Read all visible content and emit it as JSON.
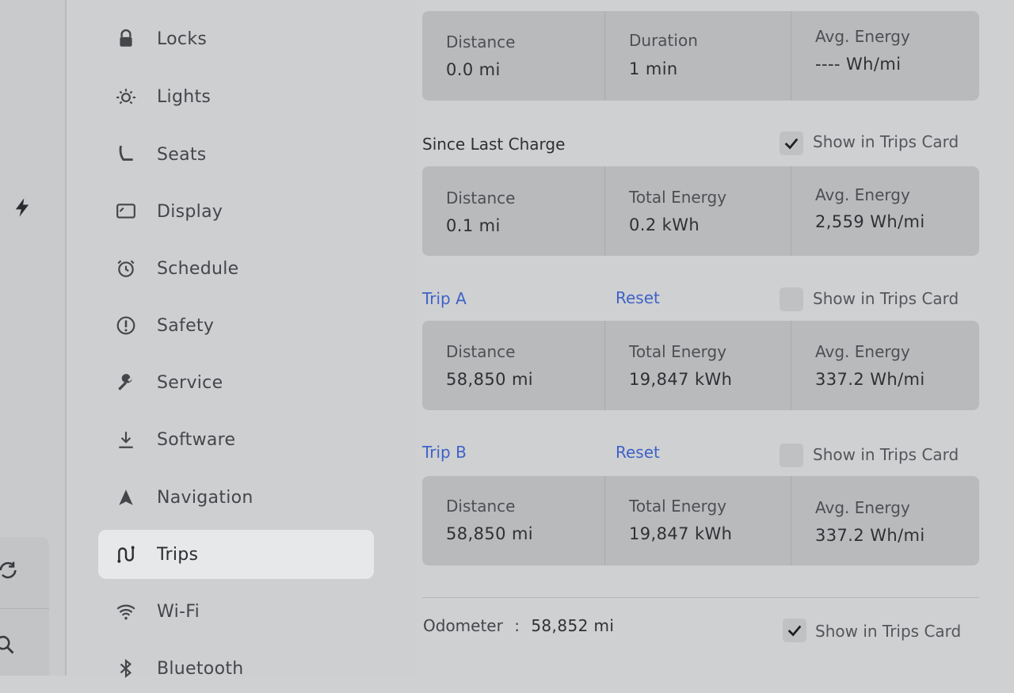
{
  "sidebar": {
    "items": [
      {
        "label": "Locks",
        "icon": "lock-icon"
      },
      {
        "label": "Lights",
        "icon": "sun-icon"
      },
      {
        "label": "Seats",
        "icon": "seat-icon"
      },
      {
        "label": "Display",
        "icon": "display-icon"
      },
      {
        "label": "Schedule",
        "icon": "alarm-clock-icon"
      },
      {
        "label": "Safety",
        "icon": "alert-circle-icon"
      },
      {
        "label": "Service",
        "icon": "wrench-icon"
      },
      {
        "label": "Software",
        "icon": "download-icon"
      },
      {
        "label": "Navigation",
        "icon": "navigation-arrow-icon"
      },
      {
        "label": "Trips",
        "icon": "trips-icon",
        "active": true
      },
      {
        "label": "Wi-Fi",
        "icon": "wifi-icon"
      },
      {
        "label": "Bluetooth",
        "icon": "bluetooth-icon"
      }
    ]
  },
  "current_drive": {
    "cells": [
      {
        "label": "Distance",
        "value": "0.0 mi"
      },
      {
        "label": "Duration",
        "value": "1 min"
      },
      {
        "label": "Avg. Energy",
        "value": "---- Wh/mi"
      }
    ]
  },
  "since_last_charge": {
    "title": "Since Last Charge",
    "show_label": "Show in Trips Card",
    "checked": true,
    "cells": [
      {
        "label": "Distance",
        "value": "0.1 mi"
      },
      {
        "label": "Total Energy",
        "value": "0.2 kWh"
      },
      {
        "label": "Avg. Energy",
        "value": "2,559 Wh/mi"
      }
    ]
  },
  "trip_a": {
    "title": "Trip A",
    "reset_label": "Reset",
    "show_label": "Show in Trips Card",
    "checked": false,
    "cells": [
      {
        "label": "Distance",
        "value": "58,850 mi"
      },
      {
        "label": "Total Energy",
        "value": "19,847 kWh"
      },
      {
        "label": "Avg. Energy",
        "value": "337.2 Wh/mi"
      }
    ]
  },
  "trip_b": {
    "title": "Trip B",
    "reset_label": "Reset",
    "show_label": "Show in Trips Card",
    "checked": false,
    "cells": [
      {
        "label": "Distance",
        "value": "58,850 mi"
      },
      {
        "label": "Total Energy",
        "value": "19,847 kWh"
      },
      {
        "label": "Avg. Energy",
        "value": "337.2 Wh/mi"
      }
    ]
  },
  "odometer": {
    "label": "Odometer",
    "separator": ":",
    "value": "58,852 mi",
    "show_label": "Show in Trips Card",
    "checked": true
  },
  "colors": {
    "accent_link": "#3e62c7",
    "active_item_bg": "#e7e8ea",
    "card_bg": "#b9babc"
  }
}
